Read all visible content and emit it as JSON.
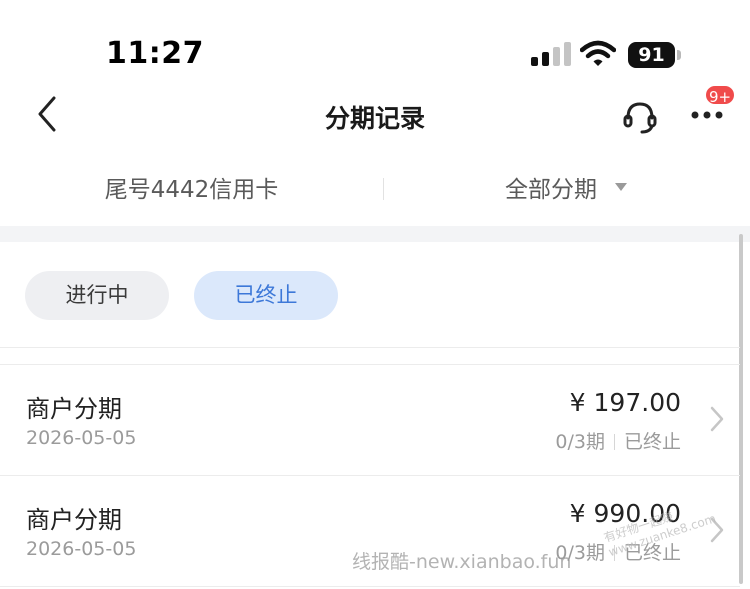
{
  "status_bar": {
    "time": "11:27",
    "battery": "91"
  },
  "nav": {
    "title": "分期记录",
    "badge": "9+"
  },
  "filters": {
    "card": "尾号4442信用卡",
    "type": "全部分期"
  },
  "tabs": [
    {
      "label": "进行中"
    },
    {
      "label": "已终止"
    }
  ],
  "records": [
    {
      "title": "商户分期",
      "date": "2026-05-05",
      "amount": "¥ 197.00",
      "periods": "0/3期",
      "status": "已终止"
    },
    {
      "title": "商户分期",
      "date": "2026-05-05",
      "amount": "¥ 990.00",
      "periods": "0/3期",
      "status": "已终止"
    }
  ],
  "watermark": {
    "text": "线报酷-new.xianbao.fun",
    "stamp": "有好物一起赚 www.zuanke8.com"
  },
  "colors": {
    "accent": "#3d78d8",
    "tab_active_bg": "#dbe8fb",
    "badge": "#f04b4b"
  },
  "icons": [
    "back-icon",
    "headset-icon",
    "more-icon",
    "caret-down-icon",
    "chevron-right-icon",
    "signal-icon",
    "wifi-icon",
    "battery-icon"
  ]
}
